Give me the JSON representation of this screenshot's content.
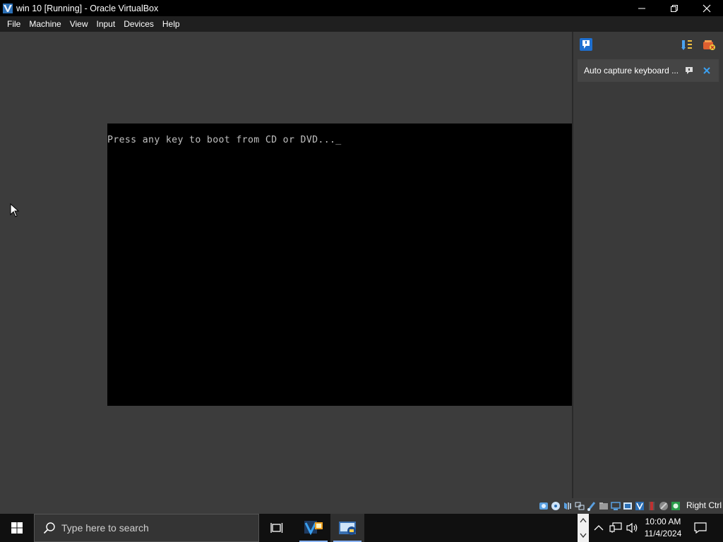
{
  "window": {
    "title": "win 10 [Running] - Oracle VirtualBox"
  },
  "menu": [
    "File",
    "Machine",
    "View",
    "Input",
    "Devices",
    "Help"
  ],
  "guest": {
    "console_text": "Press any key to boot from CD or DVD..._"
  },
  "notification": {
    "message": "Auto capture keyboard ..."
  },
  "statusbar": {
    "host_key": "Right Ctrl"
  },
  "taskbar": {
    "search_placeholder": "Type here to search",
    "clock_time": "10:00 AM",
    "clock_date": "11/4/2024"
  },
  "colors": {
    "accent": "#8ab4f8",
    "panel": "#3a3a3a",
    "titlebar": "#000000"
  }
}
